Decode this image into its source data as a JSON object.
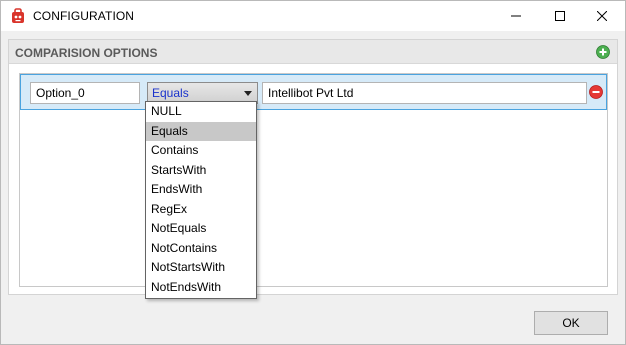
{
  "window": {
    "title": "CONFIGURATION",
    "controls": [
      "minimize-icon",
      "maximize-icon",
      "close-icon"
    ]
  },
  "group": {
    "title": "COMPARISION OPTIONS",
    "add_icon": "add-icon"
  },
  "option_row": {
    "name": "Option_0",
    "operator": "Equals",
    "value": "Intellibot Pvt Ltd",
    "remove_icon": "remove-icon"
  },
  "dropdown": {
    "selected": "Equals",
    "items": [
      "NULL",
      "Equals",
      "Contains",
      "StartsWith",
      "EndsWith",
      "RegEx",
      "NotEquals",
      "NotContains",
      "NotStartsWith",
      "NotEndsWith"
    ]
  },
  "footer": {
    "ok_label": "OK"
  },
  "colors": {
    "row_background": "#d6eaf8",
    "row_border": "#4aa3df",
    "operator_text": "#1a33cc",
    "add_icon": "#4caf50",
    "remove_icon": "#e53935",
    "app_icon": "#d9342b"
  }
}
